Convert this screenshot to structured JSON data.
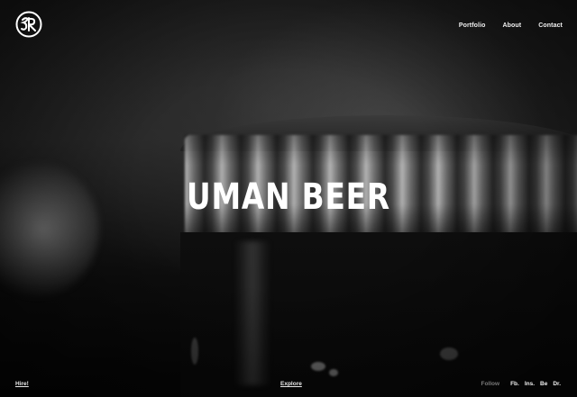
{
  "header": {
    "logo_icon": "monogram-logo-icon",
    "nav": [
      {
        "label": "Portfolio"
      },
      {
        "label": "About"
      },
      {
        "label": "Contact"
      }
    ]
  },
  "hero": {
    "title": "UMAN BEER"
  },
  "footer": {
    "hire": "Hire!",
    "explore": "Explore",
    "follow": "Follow",
    "social": [
      {
        "label": "Fb."
      },
      {
        "label": "Ins."
      },
      {
        "label": "Be"
      },
      {
        "label": "Dr."
      }
    ]
  },
  "colors": {
    "background": "#0b0b0b",
    "text": "#ffffff",
    "muted": "#7a7a7a"
  }
}
